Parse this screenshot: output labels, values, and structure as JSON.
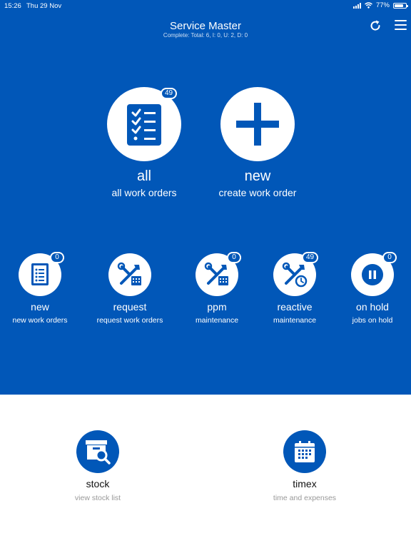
{
  "status_bar": {
    "time": "15:26",
    "date": "Thu 29 Nov",
    "battery": "77%",
    "battery_level": 0.77
  },
  "header": {
    "title": "Service Master",
    "subtitle": "Complete: Total: 6, I: 0, U: 2, D: 0"
  },
  "main_actions": [
    {
      "label": "all",
      "sub": "all work orders",
      "badge": "49",
      "icon": "checklist-icon"
    },
    {
      "label": "new",
      "sub": "create work order",
      "icon": "plus-icon"
    }
  ],
  "categories": [
    {
      "label": "new",
      "sub": "new work orders",
      "badge": "0",
      "icon": "list-icon"
    },
    {
      "label": "request",
      "sub": "request work orders",
      "icon": "tools-calendar-icon"
    },
    {
      "label": "ppm",
      "sub": "maintenance",
      "badge": "0",
      "icon": "tools-calendar-icon"
    },
    {
      "label": "reactive",
      "sub": "maintenance",
      "badge": "49",
      "icon": "tools-clock-icon"
    },
    {
      "label": "on hold",
      "sub": "jobs on hold",
      "badge": "0",
      "icon": "pause-icon"
    }
  ],
  "bottom": [
    {
      "label": "stock",
      "sub": "view stock list",
      "icon": "stock-search-icon"
    },
    {
      "label": "timex",
      "sub": "time and expenses",
      "icon": "calendar-icon"
    }
  ],
  "colors": {
    "brand_blue": "#0157b8",
    "white": "#ffffff",
    "muted_gray": "#999999"
  }
}
